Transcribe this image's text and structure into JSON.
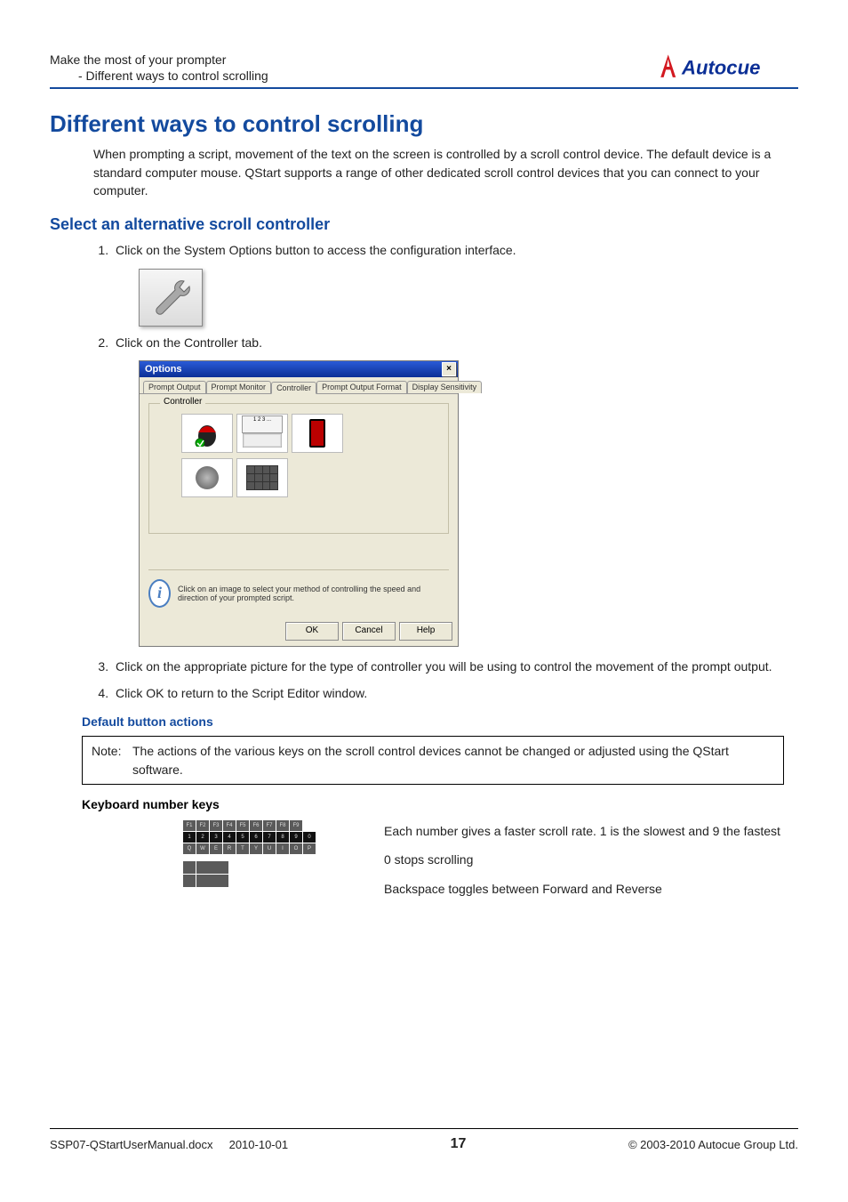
{
  "header": {
    "line1": "Make the most of your prompter",
    "line2": "- Different ways to control scrolling",
    "logo_text": "Autocue"
  },
  "title": "Different ways to control scrolling",
  "intro": "When prompting a script, movement of the text on the screen is controlled by a scroll control device. The default device is a standard computer mouse. QStart supports a range of other dedicated scroll control devices that you can connect to your computer.",
  "section1_heading": "Select an alternative scroll controller",
  "steps": {
    "s1": "Click on the System Options button to access the configuration interface.",
    "s2": "Click on the Controller tab.",
    "s3": "Click on the appropriate picture for the type of controller you will be using to control the movement of the prompt output.",
    "s4": "Click OK to return to the Script Editor window."
  },
  "options_dialog": {
    "title": "Options",
    "tabs": {
      "t0": "Prompt Output",
      "t1": "Prompt Monitor",
      "t2": "Controller",
      "t3": "Prompt Output Format",
      "t4": "Display Sensitivity"
    },
    "fieldset_label": "Controller",
    "keyb_label": "1 2 3 ...",
    "info_text": "Click on an image to select your method of controlling the speed and direction of your prompted script.",
    "buttons": {
      "ok": "OK",
      "cancel": "Cancel",
      "help": "Help"
    }
  },
  "default_actions_heading": "Default button actions",
  "note": {
    "label": "Note:",
    "text": "The actions of the various keys on the scroll control devices cannot be changed or adjusted using the QStart software."
  },
  "kbd_heading": "Keyboard number keys",
  "kbd_text": {
    "p1": "Each number gives a faster scroll rate. 1 is the slowest and 9 the fastest",
    "p2": "0 stops scrolling",
    "p3": "Backspace toggles between Forward and Reverse"
  },
  "footer": {
    "doc": "SSP07-QStartUserManual.docx",
    "date": "2010-10-01",
    "page": "17",
    "copyright": "© 2003-2010 Autocue Group Ltd."
  }
}
